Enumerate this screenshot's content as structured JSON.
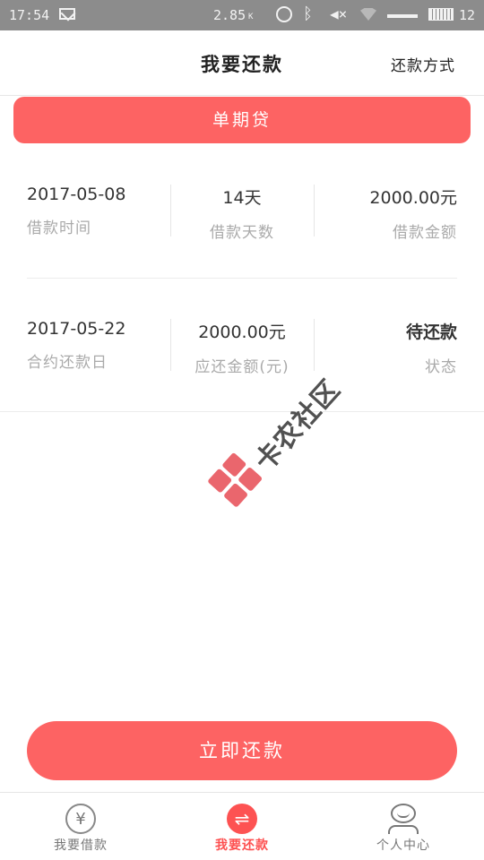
{
  "status_bar": {
    "time": "17:54",
    "net_speed": "2.85",
    "net_speed_unit": "K",
    "battery_level": "12"
  },
  "header": {
    "title": "我要还款",
    "method_link": "还款方式"
  },
  "product": {
    "label": "单期贷"
  },
  "loan_row": {
    "date": {
      "value": "2017-05-08",
      "label": "借款时间"
    },
    "days": {
      "value": "14天",
      "label": "借款天数"
    },
    "amount": {
      "value": "2000.00元",
      "label": "借款金额"
    }
  },
  "repay_row": {
    "due_date": {
      "value": "2017-05-22",
      "label": "合约还款日"
    },
    "due_amount": {
      "value": "2000.00元",
      "label": "应还金额(元)"
    },
    "status": {
      "value": "待还款",
      "label": "状态"
    }
  },
  "watermark": {
    "text": "卡农社区"
  },
  "repay_button": {
    "label": "立即还款"
  },
  "bottom_nav": {
    "items": [
      {
        "label": "我要借款",
        "icon": "yen-icon"
      },
      {
        "label": "我要还款",
        "icon": "repay-icon",
        "active": true
      },
      {
        "label": "个人中心",
        "icon": "user-icon"
      }
    ]
  },
  "colors": {
    "accent": "#fd6363",
    "status_bar": "#8c8c8c",
    "text_primary": "#333333",
    "text_secondary": "#aaaaaa"
  }
}
